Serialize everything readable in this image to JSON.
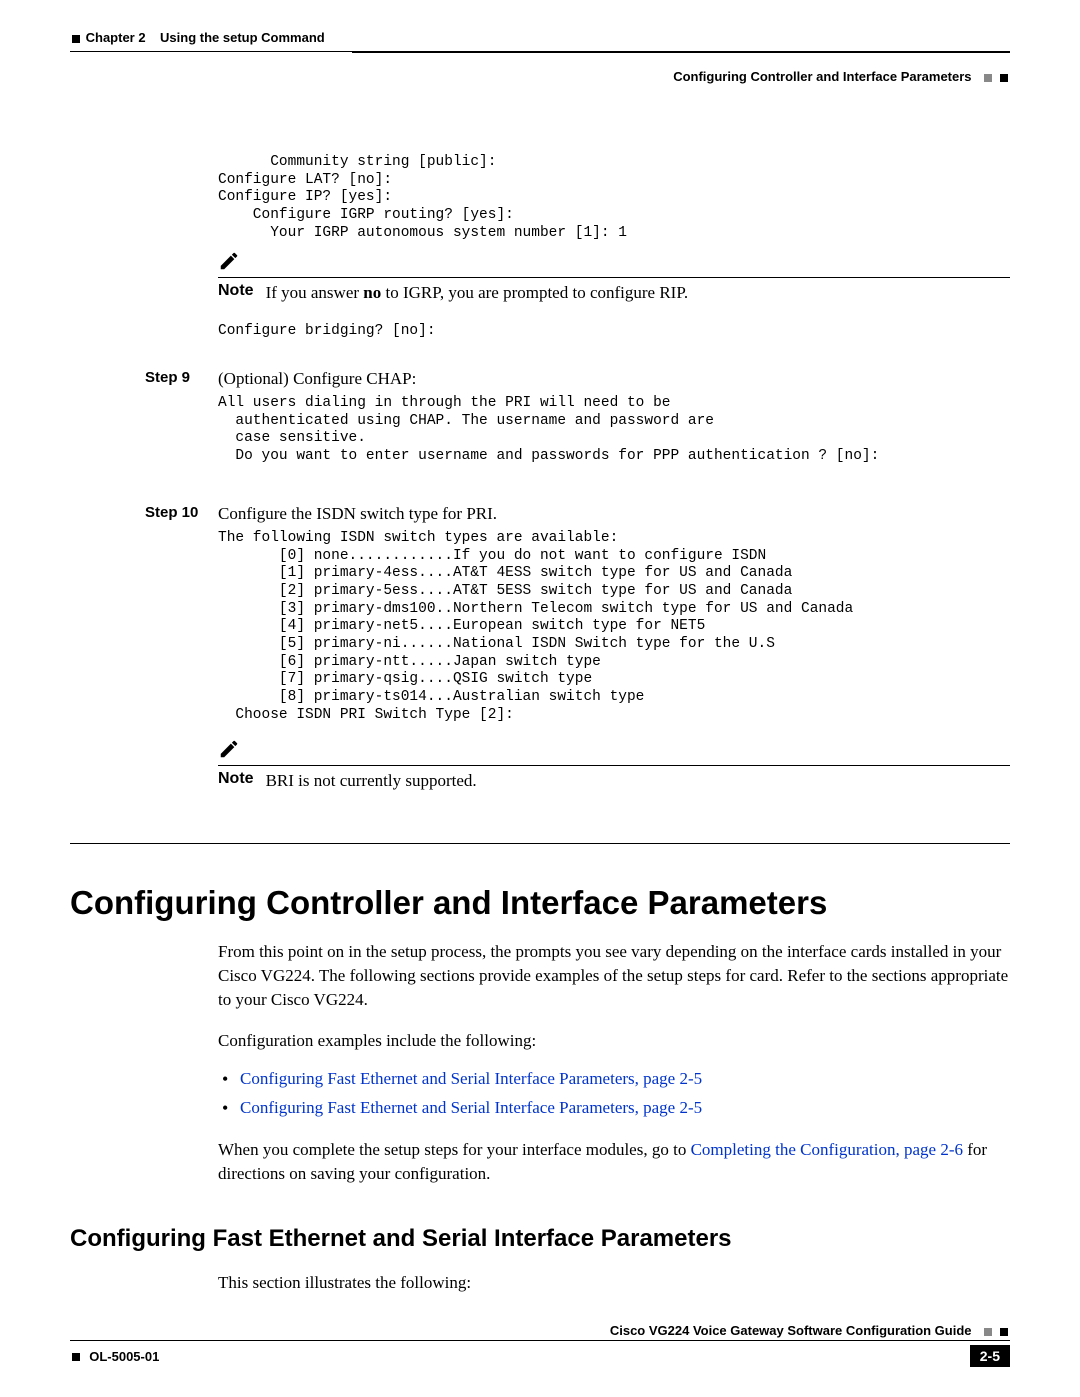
{
  "header": {
    "chapter_label": "Chapter 2",
    "chapter_title": "Using the setup Command",
    "section_title": "Configuring Controller and Interface Parameters"
  },
  "code_block_1": "      Community string [public]:\nConfigure LAT? [no]:\nConfigure IP? [yes]:\n    Configure IGRP routing? [yes]:\n      Your IGRP autonomous system number [1]: 1",
  "note1": {
    "label": "Note",
    "prefix": "If you answer ",
    "bold": "no",
    "suffix": " to IGRP, you are prompted to configure RIP."
  },
  "code_block_2": "Configure bridging? [no]:",
  "step9": {
    "label": "Step 9",
    "text": "(Optional) Configure CHAP:"
  },
  "code_block_3": "All users dialing in through the PRI will need to be\n  authenticated using CHAP. The username and password are\n  case sensitive.\n  Do you want to enter username and passwords for PPP authentication ? [no]:",
  "step10": {
    "label": "Step 10",
    "text": "Configure the ISDN switch type for PRI."
  },
  "code_block_4": "The following ISDN switch types are available:\n       [0] none............If you do not want to configure ISDN\n       [1] primary-4ess....AT&T 4ESS switch type for US and Canada\n       [2] primary-5ess....AT&T 5ESS switch type for US and Canada\n       [3] primary-dms100..Northern Telecom switch type for US and Canada\n       [4] primary-net5....European switch type for NET5\n       [5] primary-ni......National ISDN Switch type for the U.S\n       [6] primary-ntt.....Japan switch type\n       [7] primary-qsig....QSIG switch type\n       [8] primary-ts014...Australian switch type\n  Choose ISDN PRI Switch Type [2]:",
  "note2": {
    "label": "Note",
    "text": "BRI is not currently supported."
  },
  "h1": "Configuring Controller and Interface Parameters",
  "para1": "From this point on in the setup process, the prompts you see vary depending on the interface cards installed in your Cisco VG224. The following sections provide examples of the setup steps for card. Refer to the sections appropriate to your Cisco VG224.",
  "para2": "Configuration examples include the following:",
  "bullets": [
    "Configuring Fast Ethernet and Serial Interface Parameters, page 2-5",
    "Configuring Fast Ethernet and Serial Interface Parameters, page 2-5"
  ],
  "para3_prefix": "When you complete the setup steps for your interface modules, go to ",
  "para3_link": "Completing the Configuration, page 2-6",
  "para3_suffix": " for directions on saving your configuration.",
  "h2": "Configuring Fast Ethernet and Serial Interface Parameters",
  "para4": "This section illustrates the following:",
  "footer": {
    "doc_title": "Cisco VG224 Voice Gateway Software Configuration Guide",
    "doc_id": "OL-5005-01",
    "page_num": "2-5"
  }
}
